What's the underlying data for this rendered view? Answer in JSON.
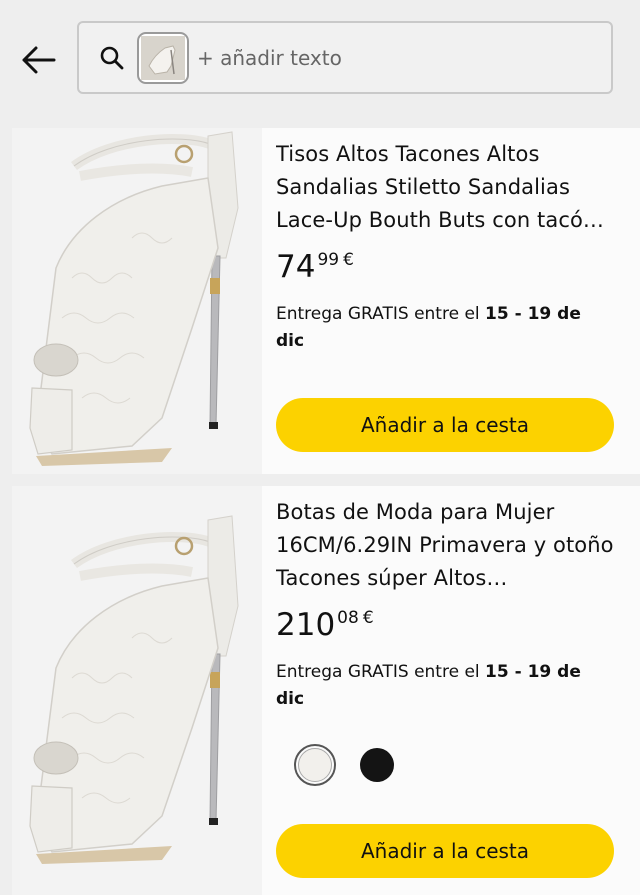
{
  "search": {
    "placeholder": "+ añadir texto"
  },
  "products": [
    {
      "title": "Tisos Altos Tacones Altos Sandalias Stiletto Sandalias Lace-Up Bouth Buts con tacó…",
      "price_whole": "74",
      "price_fraction": "99",
      "currency": "€",
      "delivery_prefix": "Entrega GRATIS entre el ",
      "delivery_dates": "15 - 19 de dic",
      "button": "Añadir a la cesta"
    },
    {
      "title": "Botas de Moda para Mujer 16CM/6.29IN Primavera y otoño Tacones súper Altos…",
      "price_whole": "210",
      "price_fraction": "08",
      "currency": "€",
      "delivery_prefix": "Entrega GRATIS entre el ",
      "delivery_dates": "15 - 19 de dic",
      "button": "Añadir a la cesta",
      "swatches": [
        "white",
        "black"
      ]
    }
  ],
  "colors": {
    "button": "#fcd200",
    "background": "#eeeeee",
    "card": "#fbfbfb"
  }
}
